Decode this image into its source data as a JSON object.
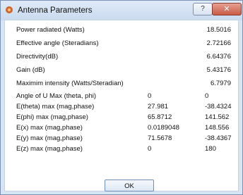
{
  "window": {
    "title": "Antenna Parameters",
    "help_label": "?",
    "close_label": "✕",
    "ok_label": "OK"
  },
  "params": [
    {
      "label": "Power radiated (Watts)",
      "value": "18.5016"
    },
    {
      "label": "Effective angle (Steradians)",
      "value": "2.72166"
    },
    {
      "label": "Directivity(dB)",
      "value": "6.64376"
    },
    {
      "label": "Gain (dB)",
      "value": "5.43176"
    },
    {
      "label": "Maximim intensity (Watts/Steradian)",
      "value": "6.7979"
    }
  ],
  "pairs": [
    {
      "label": "Angle of U Max (theta, phi)",
      "v1": "0",
      "v2": "0"
    },
    {
      "label": "E(theta) max (mag,phase)",
      "v1": "27.981",
      "v2": "-38.4324"
    },
    {
      "label": "E(phi) max (mag,phase)",
      "v1": "65.8712",
      "v2": "141.562"
    },
    {
      "label": "E(x) max (mag,phase)",
      "v1": "0.0189048",
      "v2": "148.556"
    },
    {
      "label": "E(y) max (mag,phase)",
      "v1": "71.5678",
      "v2": "-38.4367"
    },
    {
      "label": "E(z) max (mag,phase)",
      "v1": "0",
      "v2": "180"
    }
  ]
}
